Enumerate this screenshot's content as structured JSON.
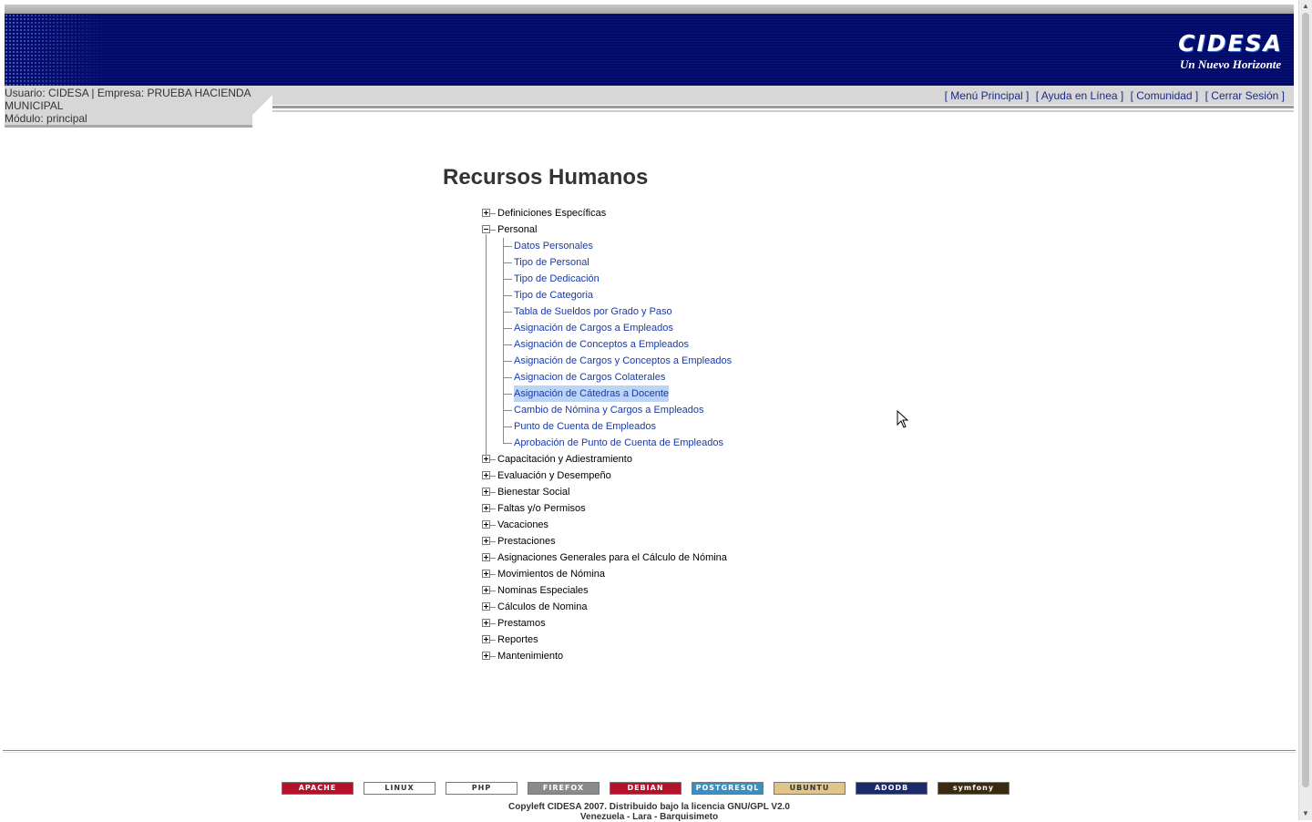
{
  "header": {
    "logo_text": "CIDESA",
    "tagline": "Un Nuevo Horizonte",
    "user_line": "Usuario: CIDESA | Empresa: PRUEBA HACIENDA MUNICIPAL",
    "module_line": "Módulo: principal",
    "nav": [
      {
        "label": "[ Menú Principal ]"
      },
      {
        "label": "[ Ayuda en Línea ]"
      },
      {
        "label": "[ Comunidad ]"
      },
      {
        "label": "[ Cerrar Sesión ]"
      }
    ],
    "banner_color": "#000a6a"
  },
  "page": {
    "title": "Recursos Humanos"
  },
  "tree": {
    "items": [
      {
        "label": "Definiciones Específicas",
        "expanded": false
      },
      {
        "label": "Personal",
        "expanded": true,
        "children": [
          "Datos Personales",
          "Tipo de Personal",
          "Tipo de Dedicación",
          "Tipo de Categoria",
          "Tabla de Sueldos por Grado y Paso",
          "Asignación de Cargos a Empleados",
          "Asignación de Conceptos a Empleados",
          "Asignación de Cargos y Conceptos a Empleados",
          "Asignacion de Cargos Colaterales",
          "Asignación de Cátedras a Docente",
          "Cambio de Nómina y Cargos a Empleados",
          "Punto de Cuenta de Empleados",
          "Aprobación de Punto de Cuenta de Empleados"
        ],
        "selected_child": "Asignación de Cátedras a Docente"
      },
      {
        "label": "Capacitación y Adiestramiento",
        "expanded": false
      },
      {
        "label": "Evaluación y Desempeño",
        "expanded": false
      },
      {
        "label": "Bienestar Social",
        "expanded": false
      },
      {
        "label": "Faltas y/o Permisos",
        "expanded": false
      },
      {
        "label": "Vacaciones",
        "expanded": false
      },
      {
        "label": "Prestaciones",
        "expanded": false
      },
      {
        "label": "Asignaciones Generales para el Cálculo de Nómina",
        "expanded": false
      },
      {
        "label": "Movimientos de Nómina",
        "expanded": false
      },
      {
        "label": "Nominas Especiales",
        "expanded": false
      },
      {
        "label": "Cálculos de Nomina",
        "expanded": false
      },
      {
        "label": "Prestamos",
        "expanded": false
      },
      {
        "label": "Reportes",
        "expanded": false
      },
      {
        "label": "Mantenimiento",
        "expanded": false
      }
    ]
  },
  "footer": {
    "badges": [
      {
        "label": "APACHE",
        "icon": "apache-feather-icon",
        "color": "#b3122a"
      },
      {
        "label": "LINUX",
        "icon": "tux-icon",
        "color": "#ffffff"
      },
      {
        "label": "PHP",
        "icon": "php-icon",
        "color": "#ffffff"
      },
      {
        "label": "FIREFOX",
        "icon": "firefox-icon",
        "color": "#8a8a8a"
      },
      {
        "label": "DEBIAN",
        "icon": "debian-swirl-icon",
        "color": "#b3122a"
      },
      {
        "label": "POSTGRESQL POWERED",
        "icon": "postgresql-icon",
        "color": "#3a8fc0"
      },
      {
        "label": "UBUNTU",
        "icon": "ubuntu-icon",
        "color": "#e0c58a"
      },
      {
        "label": "ADODB POWERED",
        "icon": "adodb-icon",
        "color": "#1a2a6a"
      },
      {
        "label": "symfony",
        "icon": "symfony-icon",
        "color": "#3a2a10"
      }
    ],
    "line1": "Copyleft CIDESA 2007. Distribuido bajo la licencia GNU/GPL V2.0",
    "line2": "Venezuela - Lara - Barquisimeto"
  }
}
